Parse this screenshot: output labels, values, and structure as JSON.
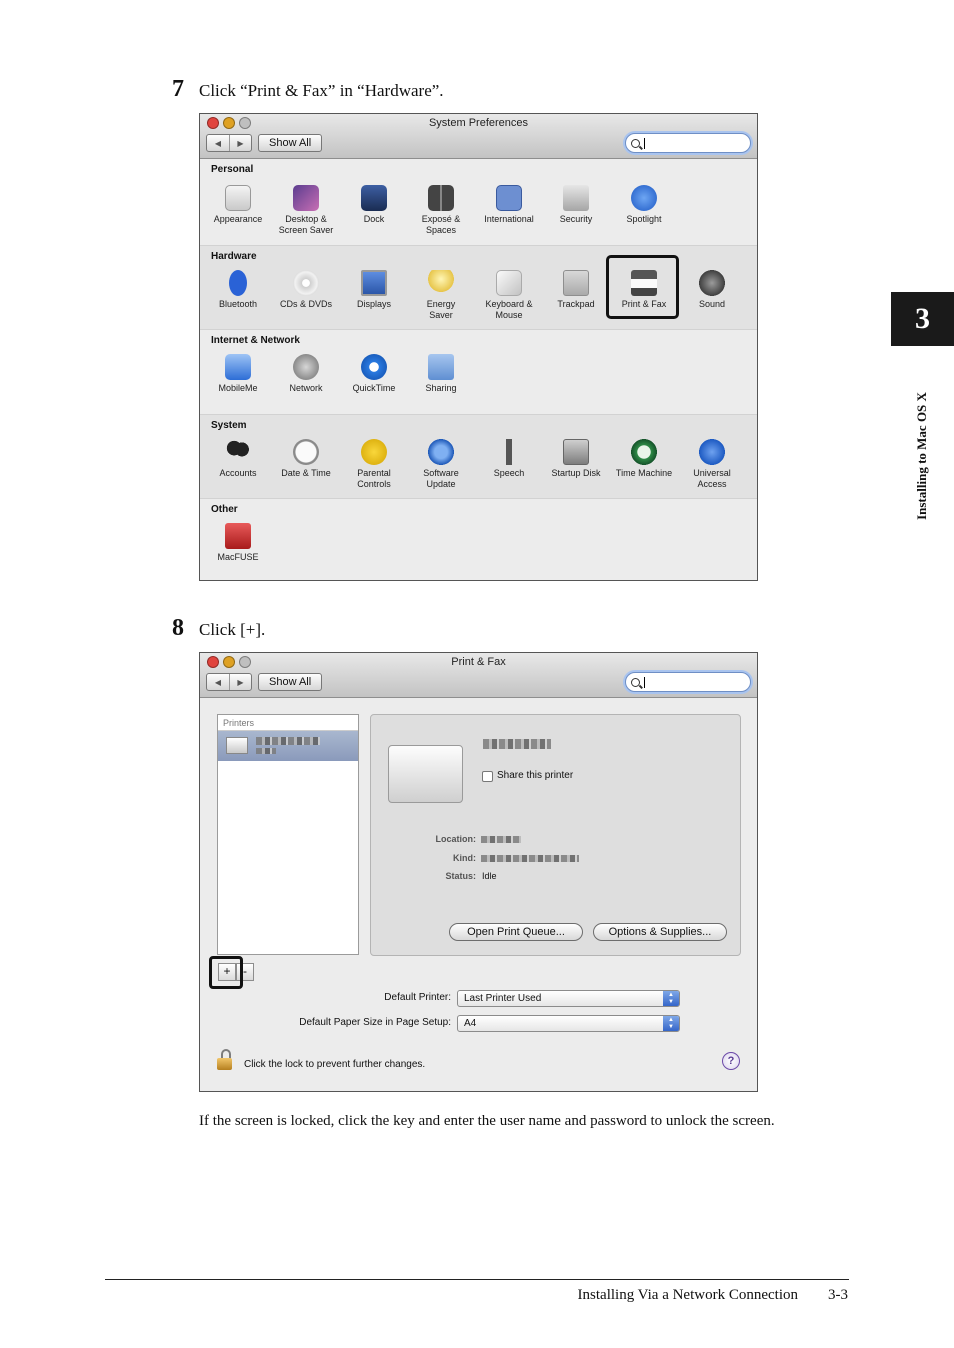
{
  "step7": {
    "number": "7",
    "text": "Click “Print & Fax” in “Hardware”."
  },
  "step8": {
    "number": "8",
    "text": "Click [+]."
  },
  "syspref": {
    "title": "System Preferences",
    "show_all": "Show All",
    "sections": {
      "personal": {
        "title": "Personal",
        "items": [
          "Appearance",
          "Desktop &\nScreen Saver",
          "Dock",
          "Exposé &\nSpaces",
          "International",
          "Security",
          "Spotlight"
        ]
      },
      "hardware": {
        "title": "Hardware",
        "items": [
          "Bluetooth",
          "CDs & DVDs",
          "Displays",
          "Energy\nSaver",
          "Keyboard &\nMouse",
          "Trackpad",
          "Print & Fax",
          "Sound"
        ]
      },
      "internet": {
        "title": "Internet & Network",
        "items": [
          "MobileMe",
          "Network",
          "QuickTime",
          "Sharing"
        ]
      },
      "system": {
        "title": "System",
        "items": [
          "Accounts",
          "Date & Time",
          "Parental\nControls",
          "Software\nUpdate",
          "Speech",
          "Startup Disk",
          "Time Machine",
          "Universal\nAccess"
        ]
      },
      "other": {
        "title": "Other",
        "items": [
          "MacFUSE"
        ]
      }
    }
  },
  "printfax": {
    "title": "Print & Fax",
    "show_all": "Show All",
    "printers_header": "Printers",
    "share_label": "Share this printer",
    "location_label": "Location:",
    "kind_label": "Kind:",
    "status_label": "Status:",
    "status_value": "Idle",
    "open_queue": "Open Print Queue...",
    "options_supplies": "Options & Supplies...",
    "add_button": "+",
    "remove_button": "-",
    "default_printer_label": "Default Printer:",
    "default_printer_value": "Last Printer Used",
    "paper_size_label": "Default Paper Size in Page Setup:",
    "paper_size_value": "A4",
    "lock_text": "Click the lock to prevent further changes.",
    "help": "?"
  },
  "note": "If the screen is locked, click the key and enter the user name and password to unlock the screen.",
  "side": {
    "chapter": "3",
    "label": "Installing to Mac OS X"
  },
  "footer": {
    "section": "Installing Via a Network Connection",
    "page": "3-3"
  }
}
